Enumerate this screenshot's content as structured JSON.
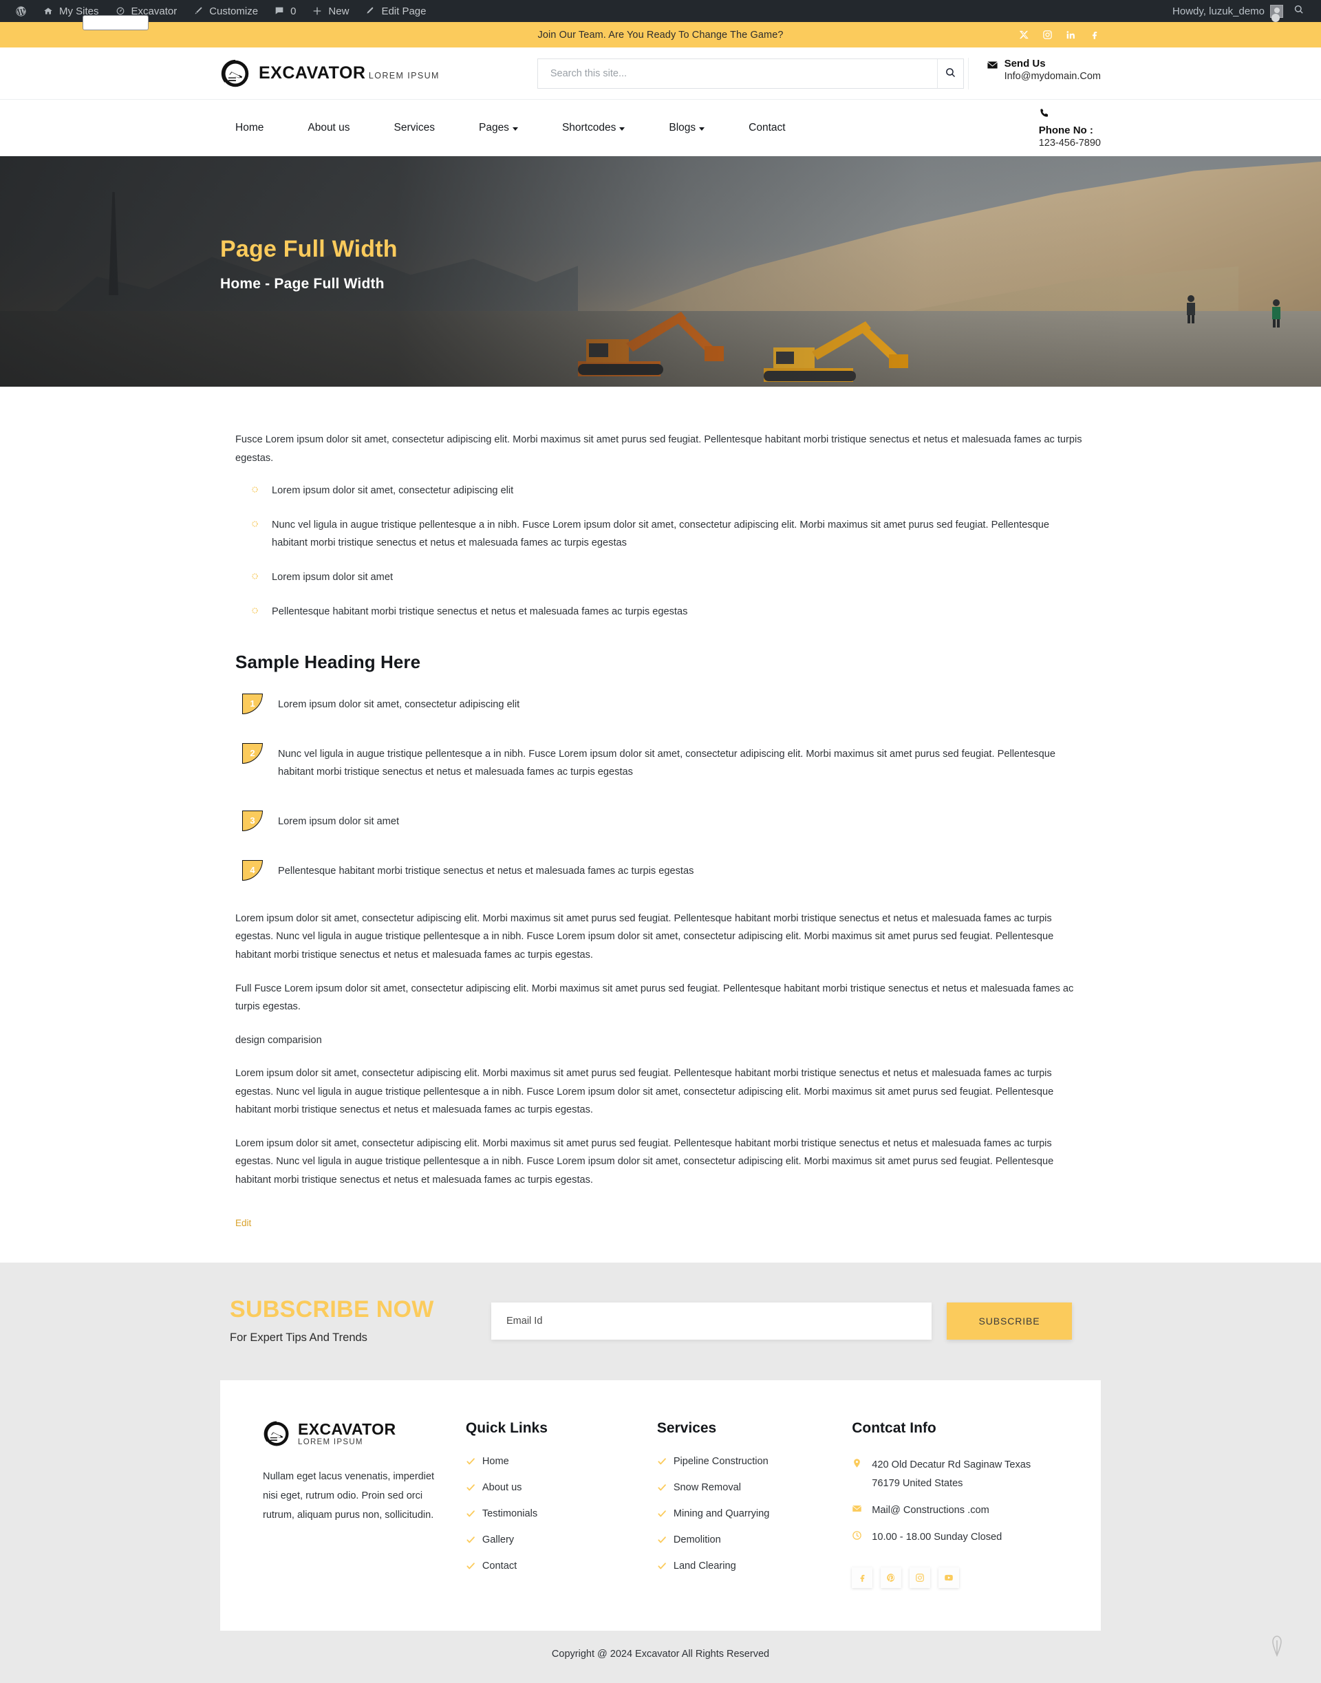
{
  "adminbar": {
    "items": [
      {
        "icon": "wordpress-icon",
        "label": ""
      },
      {
        "icon": "sites-icon",
        "label": "My Sites"
      },
      {
        "icon": "dashboard-icon",
        "label": "Excavator"
      },
      {
        "icon": "brush-icon",
        "label": "Customize"
      },
      {
        "icon": "comment-icon",
        "label": "0"
      },
      {
        "icon": "plus-icon",
        "label": "New"
      },
      {
        "icon": "pencil-icon",
        "label": "Edit Page"
      }
    ],
    "howdy": "Howdy, luzuk_demo",
    "search_icon": "search-icon"
  },
  "topbar": {
    "message": "Join Our Team. Are You Ready To Change The Game?",
    "social": [
      "x-twitter-icon",
      "instagram-icon",
      "linkedin-icon",
      "facebook-icon"
    ],
    "bg": "#fbcb5c"
  },
  "header": {
    "logo": {
      "name": "EXCAVATOR",
      "tagline": "LOREM IPSUM",
      "icon": "excavator-circle-logo"
    },
    "search": {
      "placeholder": "Search this site...",
      "value": "",
      "button_icon": "search-icon"
    },
    "contact": {
      "icon": "envelope-icon",
      "label": "Send Us",
      "value": "Info@mydomain.Com"
    }
  },
  "nav": {
    "items": [
      {
        "label": "Home",
        "caret": false
      },
      {
        "label": "About us",
        "caret": false
      },
      {
        "label": "Services",
        "caret": false
      },
      {
        "label": "Pages",
        "caret": true
      },
      {
        "label": "Shortcodes",
        "caret": true
      },
      {
        "label": "Blogs",
        "caret": true
      },
      {
        "label": "Contact",
        "caret": false
      }
    ],
    "phone": {
      "icon": "phone-icon",
      "label": "Phone No :",
      "value": "123-456-7890"
    }
  },
  "hero": {
    "title": "Page Full Width",
    "breadcrumb": "Home - Page Full Width",
    "title_color": "#fbcb5c"
  },
  "main": {
    "intro": "Fusce Lorem ipsum dolor sit amet, consectetur adipiscing elit. Morbi maximus sit amet purus sed feugiat. Pellentesque habitant morbi tristique senectus et netus et malesuada fames ac turpis egestas.",
    "circle_list": [
      "Lorem ipsum dolor sit amet, consectetur adipiscing elit",
      "Nunc vel ligula in augue tristique pellentesque a in nibh. Fusce Lorem ipsum dolor sit amet, consectetur adipiscing elit. Morbi maximus sit amet purus sed feugiat. Pellentesque habitant morbi tristique senectus et netus et malesuada fames ac turpis egestas",
      "Lorem ipsum dolor sit amet",
      "Pellentesque habitant morbi tristique senectus et netus et malesuada fames ac turpis egestas"
    ],
    "heading": "Sample Heading Here",
    "numbered_list": [
      {
        "num": "1",
        "text": "Lorem ipsum dolor sit amet, consectetur adipiscing elit"
      },
      {
        "num": "2",
        "text": "Nunc vel ligula in augue tristique pellentesque a in nibh. Fusce Lorem ipsum dolor sit amet, consectetur adipiscing elit. Morbi maximus sit amet purus sed feugiat. Pellentesque habitant morbi tristique senectus et netus et malesuada fames ac turpis egestas"
      },
      {
        "num": "3",
        "text": "Lorem ipsum dolor sit amet"
      },
      {
        "num": "4",
        "text": "Pellentesque habitant morbi tristique senectus et netus et malesuada fames ac turpis egestas"
      }
    ],
    "paragraphs": [
      "Lorem ipsum dolor sit amet, consectetur adipiscing elit. Morbi maximus sit amet purus sed feugiat. Pellentesque habitant morbi tristique senectus et netus et malesuada fames ac turpis egestas. Nunc vel ligula in augue tristique pellentesque a in nibh. Fusce Lorem ipsum dolor sit amet, consectetur adipiscing elit. Morbi maximus sit amet purus sed feugiat. Pellentesque habitant morbi tristique senectus et netus et malesuada fames ac turpis egestas.",
      "Full Fusce Lorem ipsum dolor sit amet, consectetur adipiscing elit. Morbi maximus sit amet purus sed feugiat. Pellentesque habitant morbi tristique senectus et netus et malesuada fames ac turpis egestas.",
      "design comparision",
      "Lorem ipsum dolor sit amet, consectetur adipiscing elit. Morbi maximus sit amet purus sed feugiat. Pellentesque habitant morbi tristique senectus et netus et malesuada fames ac turpis egestas. Nunc vel ligula in augue tristique pellentesque a in nibh. Fusce Lorem ipsum dolor sit amet, consectetur adipiscing elit. Morbi maximus sit amet purus sed feugiat. Pellentesque habitant morbi tristique senectus et netus et malesuada fames ac turpis egestas.",
      "Lorem ipsum dolor sit amet, consectetur adipiscing elit. Morbi maximus sit amet purus sed feugiat. Pellentesque habitant morbi tristique senectus et netus et malesuada fames ac turpis egestas. Nunc vel ligula in augue tristique pellentesque a in nibh. Fusce Lorem ipsum dolor sit amet, consectetur adipiscing elit. Morbi maximus sit amet purus sed feugiat. Pellentesque habitant morbi tristique senectus et netus et malesuada fames ac turpis egestas."
    ],
    "edit_link": "Edit"
  },
  "subscribe": {
    "title": "SUBSCRIBE NOW",
    "subtitle": "For Expert Tips And Trends",
    "placeholder": "Email Id",
    "value": "",
    "button": "SUBSCRIBE"
  },
  "footer": {
    "logo": {
      "name": "EXCAVATOR",
      "tagline": "LOREM IPSUM",
      "icon": "excavator-circle-logo"
    },
    "about": "Nullam eget lacus venenatis, imperdiet nisi eget, rutrum odio. Proin sed orci rutrum, aliquam purus non, sollicitudin.",
    "quick_links": {
      "heading": "Quick Links",
      "items": [
        "Home",
        "About us",
        "Testimonials",
        "Gallery",
        "Contact"
      ]
    },
    "services": {
      "heading": "Services",
      "items": [
        "Pipeline Construction",
        "Snow Removal",
        "Mining and Quarrying",
        "Demolition",
        "Land Clearing"
      ]
    },
    "contact": {
      "heading": "Contcat Info",
      "rows": [
        {
          "icon": "map-pin-icon",
          "text": "420 Old Decatur Rd Saginaw Texas 76179 United States"
        },
        {
          "icon": "envelope-icon",
          "text": "Mail@ Constructions .com"
        },
        {
          "icon": "clock-icon",
          "text": "10.00 - 18.00 Sunday Closed"
        }
      ],
      "social": [
        "facebook-icon",
        "pinterest-icon",
        "instagram-icon",
        "youtube-icon"
      ]
    },
    "copyright": "Copyright @ 2024 Excavator All Rights Reserved"
  }
}
